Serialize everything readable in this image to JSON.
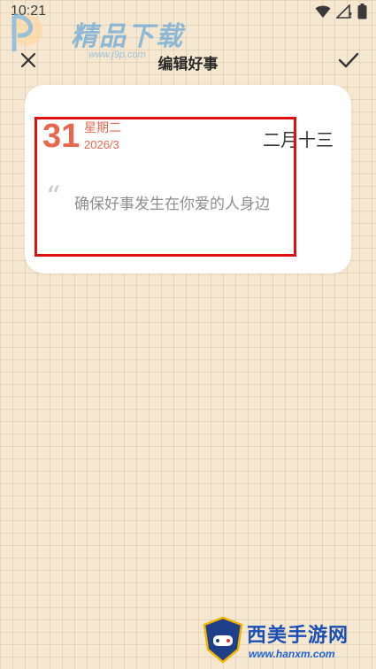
{
  "status_bar": {
    "time": "10:21",
    "icons": [
      "wifi-icon",
      "signal-no-sim-icon",
      "battery-icon"
    ]
  },
  "watermark_top": {
    "title": "精品下载",
    "url": "www.j9p.com"
  },
  "toolbar": {
    "title": "编辑好事",
    "close_icon": "close-icon",
    "confirm_icon": "check-icon"
  },
  "card": {
    "day": "31",
    "weekday": "星期二",
    "year_month": "2026/3",
    "lunar": "二月十三",
    "quote_mark": "“",
    "content": "确保好事发生在你爱的人身边"
  },
  "watermark_bottom": {
    "name": "西美手游网",
    "site": "www.hanxm.com"
  },
  "colors": {
    "background": "#f6e7d0",
    "accent": "#e8684e",
    "highlight": "#e01010"
  }
}
